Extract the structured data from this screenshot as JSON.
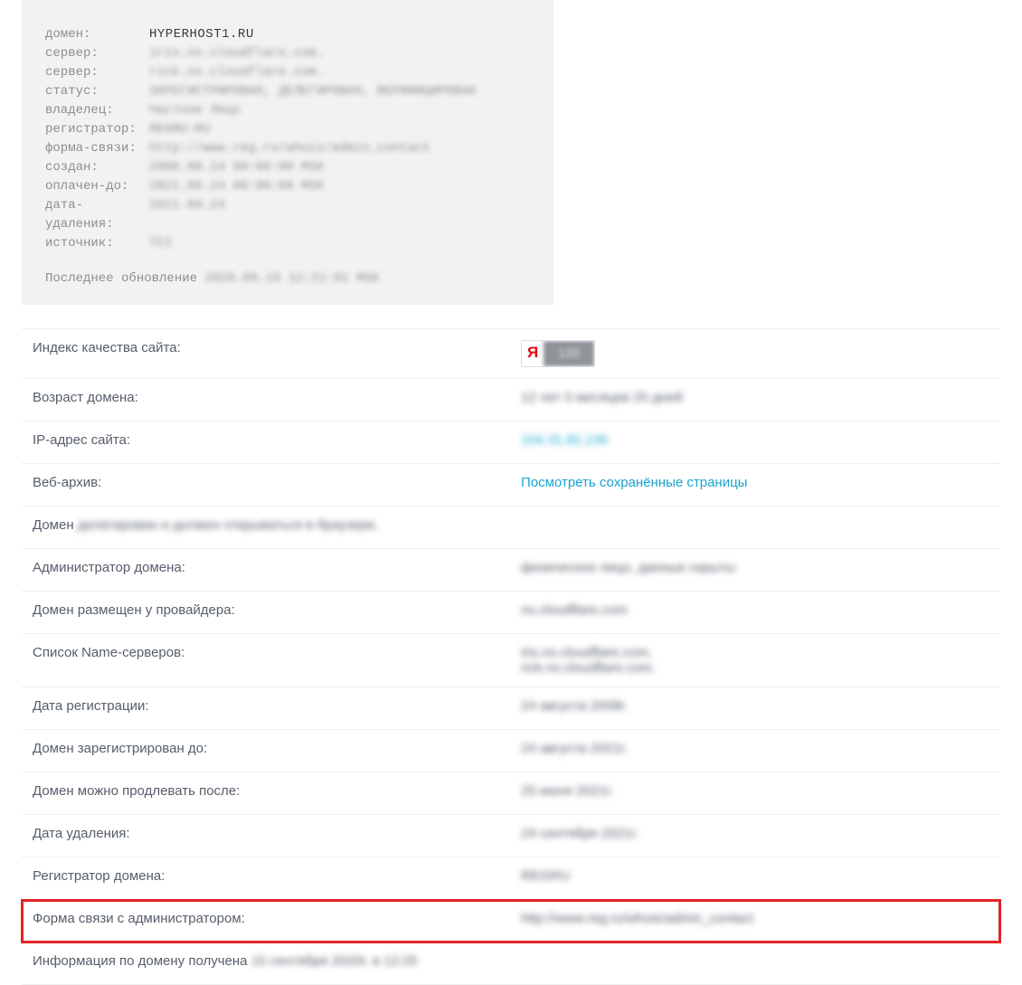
{
  "whois": {
    "rows": [
      {
        "label": "домен:",
        "value": "HYPERHOST1.RU",
        "clear": true
      },
      {
        "label": "сервер:",
        "value": "iris.ns.cloudflare.com."
      },
      {
        "label": "сервер:",
        "value": "rick.ns.cloudflare.com."
      },
      {
        "label": "статус:",
        "value": "ЗАРЕГИСТРИРОВАН, ДЕЛЕГИРОВАН, ВЕРИФИЦИРОВАН"
      },
      {
        "label": "владелец:",
        "value": "Частное Лицо"
      },
      {
        "label": "регистратор:",
        "value": "REGRU-RU"
      },
      {
        "label": "форма-связи:",
        "value": "http://www.reg.ru/whois/admin_contact"
      },
      {
        "label": "создан:",
        "value": "2008.08.24 00:00:00 MSK"
      },
      {
        "label": "оплачен-до:",
        "value": "2021.08.24 00:00:00 MSK"
      },
      {
        "label": "дата-удаления:",
        "value": "2021.09.24"
      },
      {
        "label": "источник:",
        "value": "TCI"
      }
    ],
    "update_label": "Последнее обновление",
    "update_value": "2020.09.15 12:21:01 MSK"
  },
  "details": {
    "yandex_letter": "Я",
    "yandex_score": "120",
    "rows": [
      {
        "label": "Индекс качества сайта:",
        "special": "yandex"
      },
      {
        "label": "Возраст домена:",
        "value": "12 лет 0 месяцев 25 дней",
        "blur": true
      },
      {
        "label": "IP-адрес сайта:",
        "value": "104.31.82.136",
        "blur": true,
        "link": true
      },
      {
        "label": "Веб-архив:",
        "value": "Посмотреть сохранённые страницы",
        "link": true
      },
      {
        "inlineLabel": "Домен",
        "inlineBlur": "делегирован и должен открываться в браузере."
      },
      {
        "label": "Администратор домена:",
        "value": "физическое лицо, данные скрыты",
        "blur": true
      },
      {
        "label": "Домен размещен у провайдера:",
        "value": "ns.cloudflare.com",
        "blur": true
      },
      {
        "label": "Список Name-серверов:",
        "value": "iris.ns.cloudflare.com.\nrick.ns.cloudflare.com.",
        "blur": true
      },
      {
        "label": "Дата регистрации:",
        "value": "24 августа 2008г.",
        "blur": true
      },
      {
        "label": "Домен зарегистрирован до:",
        "value": "24 августа 2021г.",
        "blur": true
      },
      {
        "label": "Домен можно продлевать после:",
        "value": "25 июня 2021г.",
        "blur": true
      },
      {
        "label": "Дата удаления:",
        "value": "24 сентября 2021г.",
        "blur": true
      },
      {
        "label": "Регистратор домена:",
        "value": "REGRU",
        "blur": true
      },
      {
        "label": "Форма связи с администратором:",
        "value": "http://www.reg.ru/whois/admin_contact",
        "blur": true,
        "highlight": true
      },
      {
        "inlineLabel": "Информация по домену получена",
        "inlineBlur": "15 сентября 2020г. в 12:25"
      }
    ]
  }
}
